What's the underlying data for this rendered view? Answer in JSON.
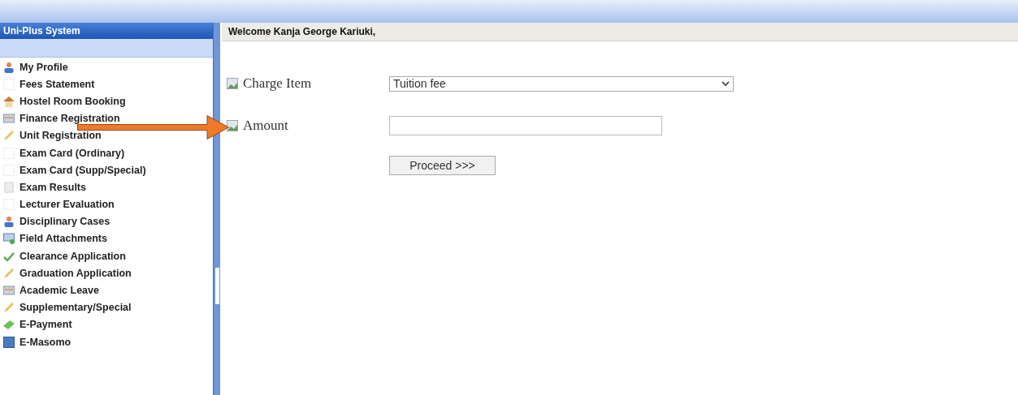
{
  "sidebar": {
    "title": "Uni-Plus System",
    "items": [
      {
        "label": "My Profile"
      },
      {
        "label": "Fees Statement"
      },
      {
        "label": "Hostel Room Booking"
      },
      {
        "label": "Finance Registration"
      },
      {
        "label": "Unit Registration"
      },
      {
        "label": "Exam Card (Ordinary)"
      },
      {
        "label": "Exam Card (Supp/Special)"
      },
      {
        "label": "Exam Results"
      },
      {
        "label": "Lecturer Evaluation"
      },
      {
        "label": "Disciplinary Cases"
      },
      {
        "label": "Field Attachments"
      },
      {
        "label": "Clearance Application"
      },
      {
        "label": "Graduation Application"
      },
      {
        "label": "Academic Leave"
      },
      {
        "label": "Supplementary/Special"
      },
      {
        "label": "E-Payment"
      },
      {
        "label": "E-Masomo"
      }
    ]
  },
  "welcome": "Welcome Kanja George Kariuki,",
  "form": {
    "fields": [
      {
        "kind": "select",
        "label": "Charge Item",
        "value": "Tuition fee"
      },
      {
        "kind": "input",
        "label": "Amount"
      }
    ],
    "button": "Proceed >>>"
  }
}
